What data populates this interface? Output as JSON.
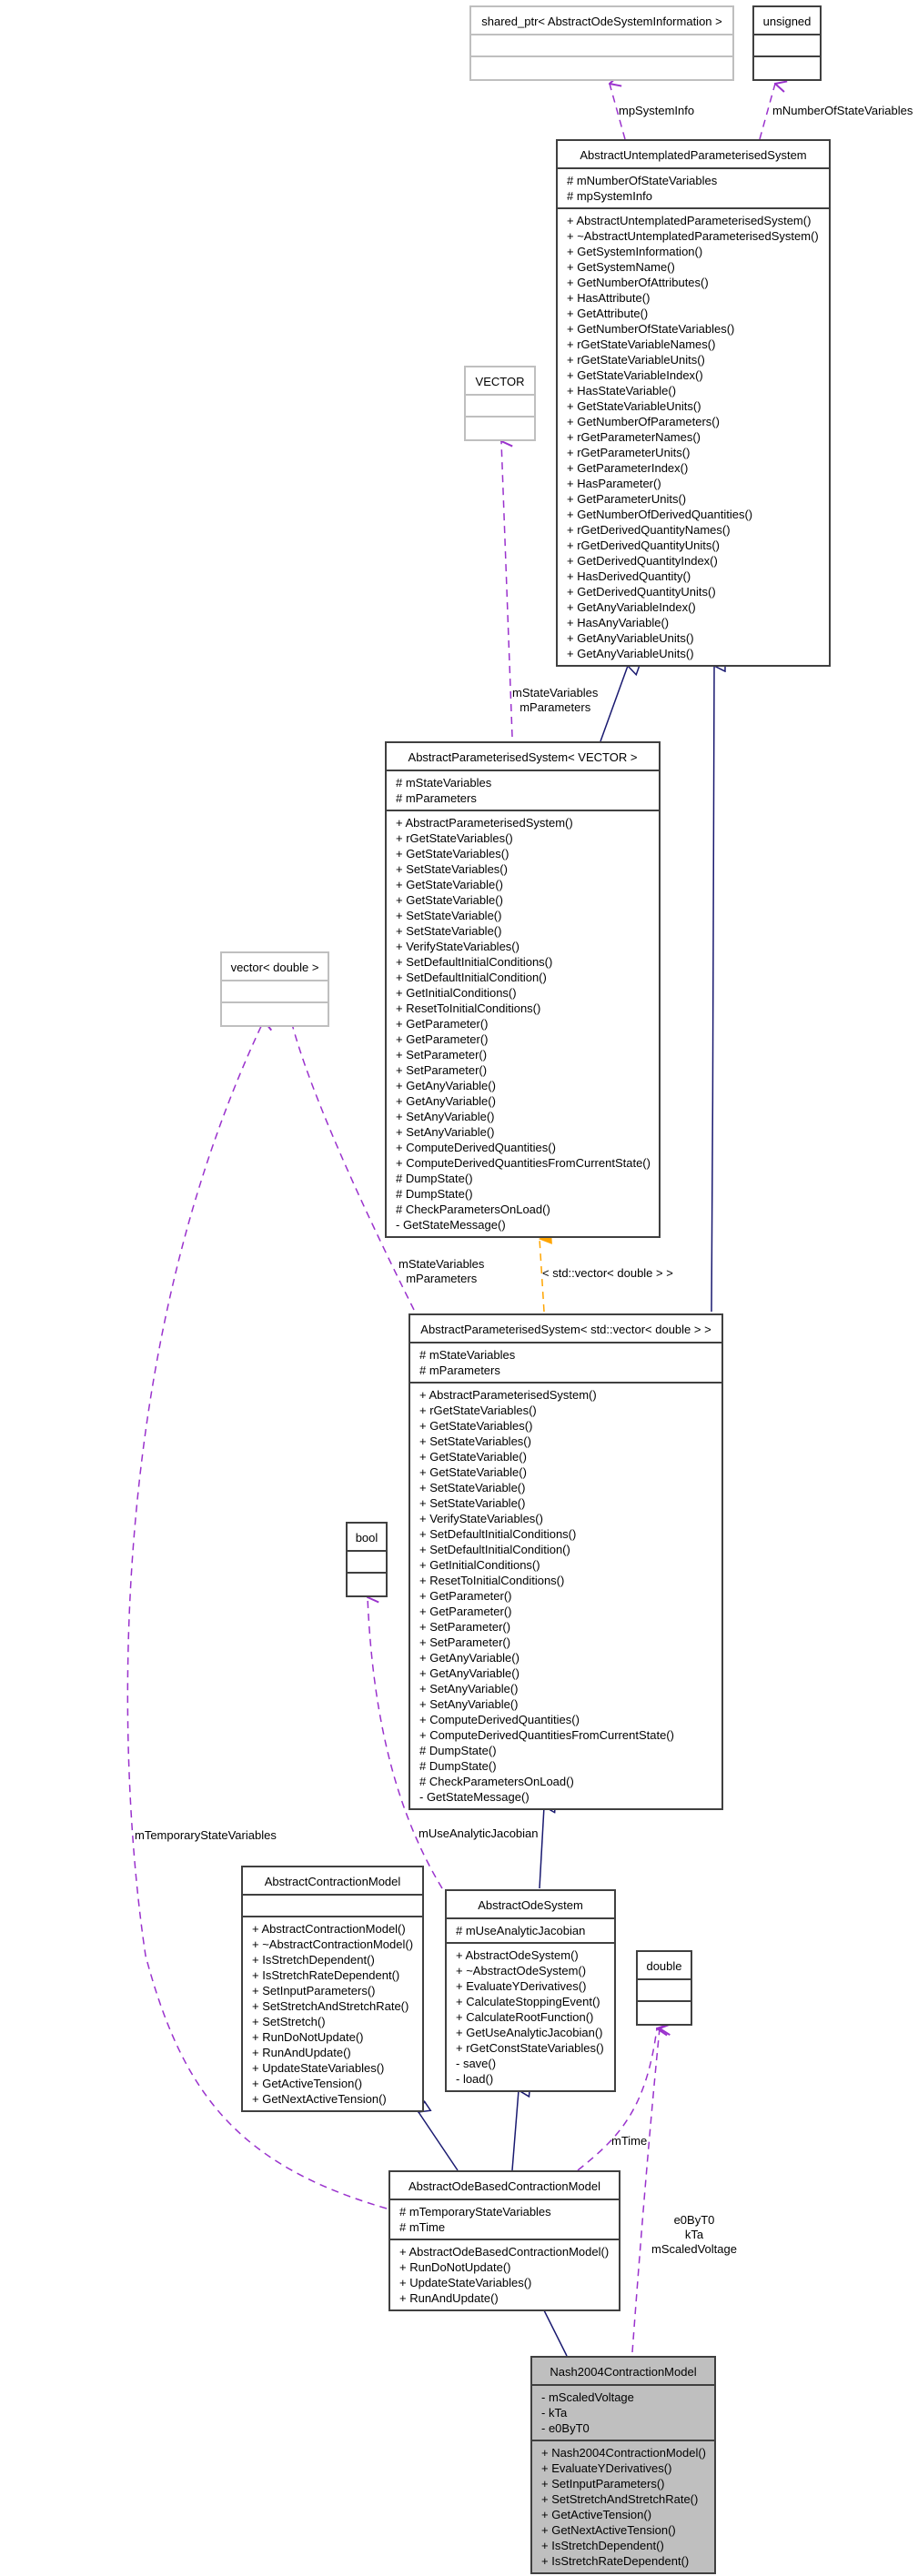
{
  "classes": {
    "shared_ptr": {
      "name": "shared_ptr< AbstractOdeSystemInformation >",
      "attributes": [],
      "methods": []
    },
    "unsigned": {
      "name": "unsigned",
      "attributes": [],
      "methods": []
    },
    "untemplated": {
      "name": "AbstractUntemplatedParameterisedSystem",
      "attributes": [
        "# mNumberOfStateVariables",
        "# mpSystemInfo"
      ],
      "methods": [
        "+ AbstractUntemplatedParameterisedSystem()",
        "+ ~AbstractUntemplatedParameterisedSystem()",
        "+ GetSystemInformation()",
        "+ GetSystemName()",
        "+ GetNumberOfAttributes()",
        "+ HasAttribute()",
        "+ GetAttribute()",
        "+ GetNumberOfStateVariables()",
        "+ rGetStateVariableNames()",
        "+ rGetStateVariableUnits()",
        "+ GetStateVariableIndex()",
        "+ HasStateVariable()",
        "+ GetStateVariableUnits()",
        "+ GetNumberOfParameters()",
        "+ rGetParameterNames()",
        "+ rGetParameterUnits()",
        "+ GetParameterIndex()",
        "+ HasParameter()",
        "+ GetParameterUnits()",
        "+ GetNumberOfDerivedQuantities()",
        "+ rGetDerivedQuantityNames()",
        "+ rGetDerivedQuantityUnits()",
        "+ GetDerivedQuantityIndex()",
        "+ HasDerivedQuantity()",
        "+ GetDerivedQuantityUnits()",
        "+ GetAnyVariableIndex()",
        "+ HasAnyVariable()",
        "+ GetAnyVariableUnits()",
        "+ GetAnyVariableUnits()"
      ]
    },
    "vector_t": {
      "name": "VECTOR",
      "attributes": [],
      "methods": []
    },
    "aps_vector": {
      "name": "AbstractParameterisedSystem< VECTOR >",
      "attributes": [
        "# mStateVariables",
        "# mParameters"
      ],
      "methods": [
        "+ AbstractParameterisedSystem()",
        "+ rGetStateVariables()",
        "+ GetStateVariables()",
        "+ SetStateVariables()",
        "+ GetStateVariable()",
        "+ GetStateVariable()",
        "+ SetStateVariable()",
        "+ SetStateVariable()",
        "+ VerifyStateVariables()",
        "+ SetDefaultInitialConditions()",
        "+ SetDefaultInitialCondition()",
        "+ GetInitialConditions()",
        "+ ResetToInitialConditions()",
        "+ GetParameter()",
        "+ GetParameter()",
        "+ SetParameter()",
        "+ SetParameter()",
        "+ GetAnyVariable()",
        "+ GetAnyVariable()",
        "+ SetAnyVariable()",
        "+ SetAnyVariable()",
        "+ ComputeDerivedQuantities()",
        "+ ComputeDerivedQuantitiesFromCurrentState()",
        "# DumpState()",
        "# DumpState()",
        "# CheckParametersOnLoad()",
        "- GetStateMessage()"
      ]
    },
    "vector_double": {
      "name": "vector< double >",
      "attributes": [],
      "methods": []
    },
    "aps_stdvector": {
      "name": "AbstractParameterisedSystem< std::vector< double > >",
      "attributes": [
        "# mStateVariables",
        "# mParameters"
      ],
      "methods": [
        "+ AbstractParameterisedSystem()",
        "+ rGetStateVariables()",
        "+ GetStateVariables()",
        "+ SetStateVariables()",
        "+ GetStateVariable()",
        "+ GetStateVariable()",
        "+ SetStateVariable()",
        "+ SetStateVariable()",
        "+ VerifyStateVariables()",
        "+ SetDefaultInitialConditions()",
        "+ SetDefaultInitialCondition()",
        "+ GetInitialConditions()",
        "+ ResetToInitialConditions()",
        "+ GetParameter()",
        "+ GetParameter()",
        "+ SetParameter()",
        "+ SetParameter()",
        "+ GetAnyVariable()",
        "+ GetAnyVariable()",
        "+ SetAnyVariable()",
        "+ SetAnyVariable()",
        "+ ComputeDerivedQuantities()",
        "+ ComputeDerivedQuantitiesFromCurrentState()",
        "# DumpState()",
        "# DumpState()",
        "# CheckParametersOnLoad()",
        "- GetStateMessage()"
      ]
    },
    "bool_t": {
      "name": "bool",
      "attributes": [],
      "methods": []
    },
    "contraction": {
      "name": "AbstractContractionModel",
      "attributes": [],
      "methods": [
        "+ AbstractContractionModel()",
        "+ ~AbstractContractionModel()",
        "+ IsStretchDependent()",
        "+ IsStretchRateDependent()",
        "+ SetInputParameters()",
        "+ SetStretchAndStretchRate()",
        "+ SetStretch()",
        "+ RunDoNotUpdate()",
        "+ RunAndUpdate()",
        "+ UpdateStateVariables()",
        "+ GetActiveTension()",
        "+ GetNextActiveTension()"
      ]
    },
    "odesystem": {
      "name": "AbstractOdeSystem",
      "attributes": [
        "# mUseAnalyticJacobian"
      ],
      "methods": [
        "+ AbstractOdeSystem()",
        "+ ~AbstractOdeSystem()",
        "+ EvaluateYDerivatives()",
        "+ CalculateStoppingEvent()",
        "+ CalculateRootFunction()",
        "+ GetUseAnalyticJacobian()",
        "+ rGetConstStateVariables()",
        "- save()",
        "- load()"
      ]
    },
    "double_t": {
      "name": "double",
      "attributes": [],
      "methods": []
    },
    "odebased": {
      "name": "AbstractOdeBasedContractionModel",
      "attributes": [
        "# mTemporaryStateVariables",
        "# mTime"
      ],
      "methods": [
        "+ AbstractOdeBasedContractionModel()",
        "+ RunDoNotUpdate()",
        "+ UpdateStateVariables()",
        "+ RunAndUpdate()"
      ]
    },
    "nash": {
      "name": "Nash2004ContractionModel",
      "attributes": [
        "- mScaledVoltage",
        "- kTa",
        "- e0ByT0"
      ],
      "methods": [
        "+ Nash2004ContractionModel()",
        "+ EvaluateYDerivatives()",
        "+ SetInputParameters()",
        "+ SetStretchAndStretchRate()",
        "+ GetActiveTension()",
        "+ GetNextActiveTension()",
        "+ IsStretchDependent()",
        "+ IsStretchRateDependent()"
      ]
    }
  },
  "edge_labels": {
    "mpSystemInfo": "mpSystemInfo",
    "mNumberOfStateVariables": "mNumberOfStateVariables",
    "vector_members": [
      "mStateVariables",
      "mParameters"
    ],
    "stdvector_members": [
      "mStateVariables",
      "mParameters"
    ],
    "template_binding": "< std::vector< double > >",
    "mUseAnalyticJacobian": "mUseAnalyticJacobian",
    "mTemporaryStateVariables": "mTemporaryStateVariables",
    "mTime": "mTime",
    "double_members": [
      "e0ByT0",
      "kTa",
      "mScaledVoltage"
    ]
  },
  "colors": {
    "inheritance": "#191970",
    "usage": "#9a32cd",
    "template": "#ffa500",
    "highlight_fill": "#bfbfbf",
    "border": "#404040",
    "undocumented_border": "#bfbfbf"
  }
}
